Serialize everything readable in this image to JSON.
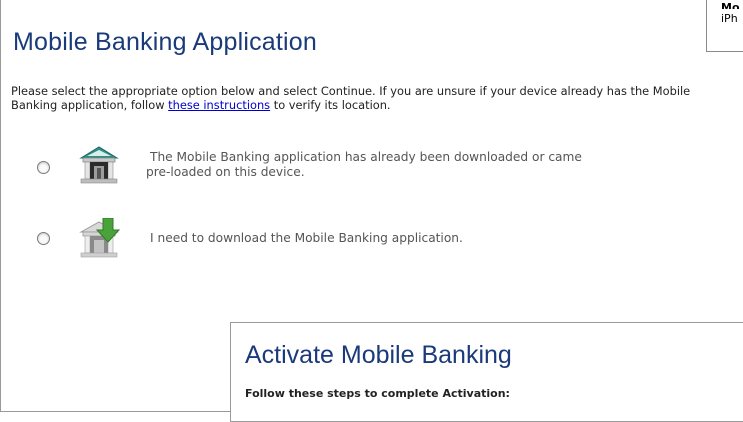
{
  "corner_card": {
    "line1": "Mo",
    "line2": "iPh"
  },
  "page": {
    "title": "Mobile Banking Application",
    "intro_before_link": "Please select the appropriate option below and select Continue. If you are unsure if your device already has the Mobile",
    "intro_line2_before_link": "Banking application, follow ",
    "intro_link": "these instructions",
    "intro_after_link": " to verify its location."
  },
  "options": [
    {
      "line1": "The Mobile Banking application has already been downloaded or came",
      "line2": "pre-loaded on this device.",
      "icon": "bank-building-icon"
    },
    {
      "line1": "I need to download the Mobile Banking application.",
      "icon": "bank-download-icon"
    }
  ],
  "dialog": {
    "title": "Activate Mobile Banking",
    "subtitle": "Follow these steps to complete Activation:"
  },
  "colors": {
    "title": "#1a3a7a",
    "link": "#0000cc",
    "icon_teal": "#2f8f86",
    "icon_green": "#4aa23a"
  }
}
